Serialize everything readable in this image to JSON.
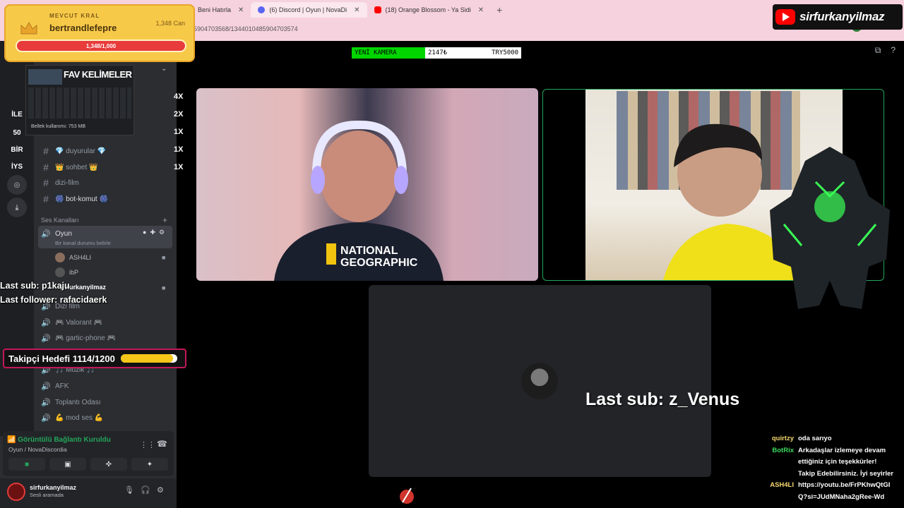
{
  "browser": {
    "tabs": [
      {
        "title": "Beni Hatırla",
        "active": false,
        "fav_color": "#aaaaaa"
      },
      {
        "title": "(6) Discord | Oyun | NovaDi",
        "active": true,
        "fav_color": "#5865f2"
      },
      {
        "title": "(18) Orange Blossom - Ya Sidi",
        "active": false,
        "fav_color": "#ff0000"
      }
    ],
    "url": "5904703568/1344010485904703574"
  },
  "youtube_badge": {
    "channel": "sirfurkanyilmaz"
  },
  "king_overlay": {
    "title": "MEVCUT KRAL",
    "name": "bertrandlefepre",
    "hp": "1,348 Can",
    "bar_text": "1,348/1,000"
  },
  "fav_panel": {
    "title": "FAV KELİMELER",
    "memory": "Bellek kullanımı: 753 MB"
  },
  "multipliers": [
    "4X",
    "2X",
    "1X",
    "1X",
    "1X"
  ],
  "rail_labels": [
    "İLE",
    "50",
    "BİR",
    "İYS"
  ],
  "sidebar": {
    "text_channels": [
      {
        "name": "💎 duyurular 💎"
      },
      {
        "name": "👑 sohbet 👑"
      },
      {
        "name": "dizi-film"
      },
      {
        "name": "🎆 bot-komut 🎆"
      }
    ],
    "voice_header": "Ses Kanalları",
    "active_voice": {
      "name": "Oyun",
      "status": "Bir kanal durumu belirle"
    },
    "members": [
      "ASH4LI",
      "ibP",
      "sirfurkanyilmaz"
    ],
    "voice_channels": [
      {
        "name": "Dizi film"
      },
      {
        "name": "🎮 Valorant 🎮"
      },
      {
        "name": "🎮 gartic-phone 🎮"
      },
      {
        "name": "🎵 Müzik 🎵"
      },
      {
        "name": "AFK"
      },
      {
        "name": "Toplantı Odası"
      },
      {
        "name": "💪 mod ses 💪"
      }
    ]
  },
  "stream_overlay": {
    "last_sub": "Last sub: p1kaju",
    "last_follower": "Last follower: rafacidaerk",
    "goal_label": "Takipçi Hedefi 1114/1200",
    "goal_progress": 0.928,
    "last_sub_center": "Last sub: z_Venus"
  },
  "voice_panel": {
    "status": "Görüntülü Bağlantı Kuruldu",
    "channel": "Oyun / NovaDiscordia",
    "buttons": [
      "camera-button",
      "screen-share-button",
      "activity-button",
      "soundboard-button"
    ]
  },
  "user_bar": {
    "username": "sirfurkanyilmaz",
    "status": "Sesli aramada"
  },
  "camera_bar": {
    "label": "YENİ KAMERA",
    "current": "2147₺",
    "target": "TRY5000"
  },
  "chat": [
    {
      "user": "quirtzy",
      "color": "#f5d76e",
      "lines": [
        "oda sarıyo"
      ]
    },
    {
      "user": "BotRix",
      "color": "#3ddc5e",
      "lines": [
        "Arkadaşlar izlemeye devam",
        "ettiğiniz için teşekkürler!",
        "Takip Edebilirsiniz. İyi seyirler"
      ]
    },
    {
      "user": "ASH4LI",
      "color": "#f5d76e",
      "lines": [
        "https://youtu.be/FrPKhwQtGI",
        "Q?si=JUdMNaha2gRee-Wd"
      ]
    }
  ],
  "colors": {
    "discord_bg": "#2b2d31",
    "online": "#23a55a",
    "king_gold": "#f7c948",
    "goal_border": "#c2185b"
  }
}
